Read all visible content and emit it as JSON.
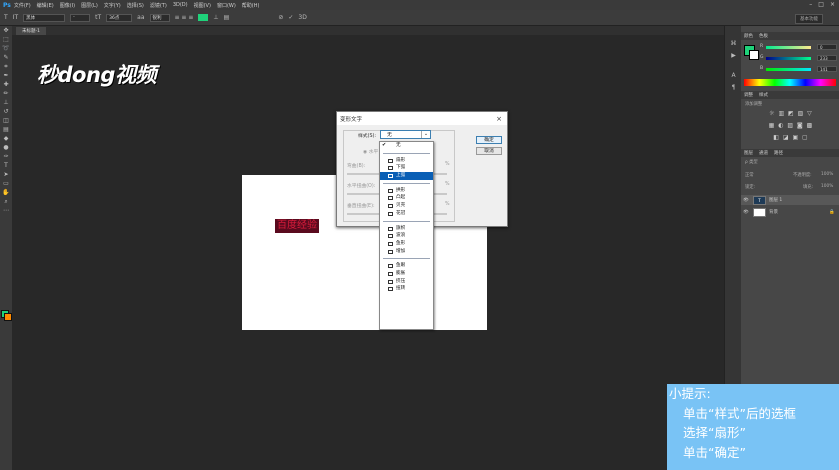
{
  "app": {
    "logo": "Ps"
  },
  "menu": [
    "文件(F)",
    "编辑(E)",
    "图像(I)",
    "图层(L)",
    "文字(Y)",
    "选择(S)",
    "滤镜(T)",
    "3D(D)",
    "视图(V)",
    "窗口(W)",
    "帮助(H)"
  ],
  "window_controls": {
    "minimize": "–",
    "maximize": "□",
    "close": "×"
  },
  "options_bar": {
    "tool_icon": "T",
    "orientation_icon": "IT",
    "font_family": "黑体",
    "font_style": "-",
    "size_icon": "tT",
    "font_size": "36点",
    "aa_label": "aa",
    "aa_mode": "锐利",
    "align_icons": "≡ ≡ ≡",
    "color_hex": "#1fd27a",
    "warp_icon": "⊥",
    "panel_icon": "▤",
    "cancel_icon": "⊘",
    "commit_icon": "✓",
    "threed_label": "3D",
    "workspace": "基本功能"
  },
  "doc_tab": {
    "title": "未标题-1"
  },
  "watermark": {
    "text": "秒dong视频"
  },
  "canvas": {
    "text": "百度经验"
  },
  "warp_dialog": {
    "title": "变形文字",
    "close": "×",
    "style_label": "样式(S):",
    "style_value": "无",
    "orientation_label": "水平",
    "bend_label": "弯曲(B):",
    "hdist_label": "水平扭曲(O):",
    "vdist_label": "垂直扭曲(E):",
    "percent": "%",
    "ok": "确定",
    "cancel": "取消"
  },
  "style_dropdown": {
    "groups": [
      [
        "无"
      ],
      [
        "扇形",
        "下弧",
        "上弧"
      ],
      [
        "拱形",
        "凸起",
        "贝壳",
        "花冠"
      ],
      [
        "旗帜",
        "波浪",
        "鱼形",
        "增加"
      ],
      [
        "鱼眼",
        "膨胀",
        "挤压",
        "扭转"
      ]
    ],
    "checked": "无",
    "highlighted": "上弧"
  },
  "right_panel": {
    "color_tabs": [
      "颜色",
      "色板"
    ],
    "color_values": {
      "r_label": "R",
      "r": "0",
      "g_label": "G",
      "g": "233",
      "b_label": "B",
      "b": "141"
    },
    "adjust_tabs": [
      "调整",
      "样式"
    ],
    "adjust_hint": "添加调整",
    "layer_tabs": [
      "图层",
      "通道",
      "路径"
    ],
    "layer_kind": "ρ 类型",
    "blend_mode": "正常",
    "opacity_label": "不透明度:",
    "opacity": "100%",
    "lock_label": "锁定:",
    "fill_label": "填充:",
    "fill": "100%",
    "layers": [
      {
        "name": "图层 1"
      },
      {
        "name": "背景"
      }
    ]
  },
  "tip": {
    "title": "小提示:",
    "lines": [
      "单击“样式”后的选框",
      "选择“扇形”",
      "单击“确定”"
    ]
  }
}
